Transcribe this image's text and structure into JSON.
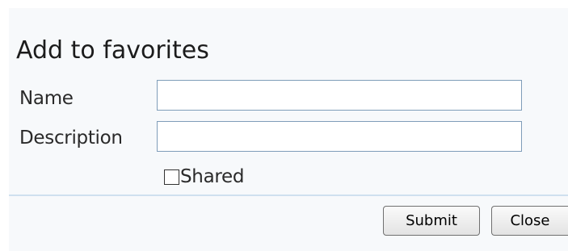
{
  "dialog": {
    "title": "Add to favorites",
    "name_label": "Name",
    "name_value": "",
    "description_label": "Description",
    "description_value": "",
    "shared_label": "Shared",
    "shared_checked": false,
    "submit_label": "Submit",
    "close_label": "Close"
  }
}
